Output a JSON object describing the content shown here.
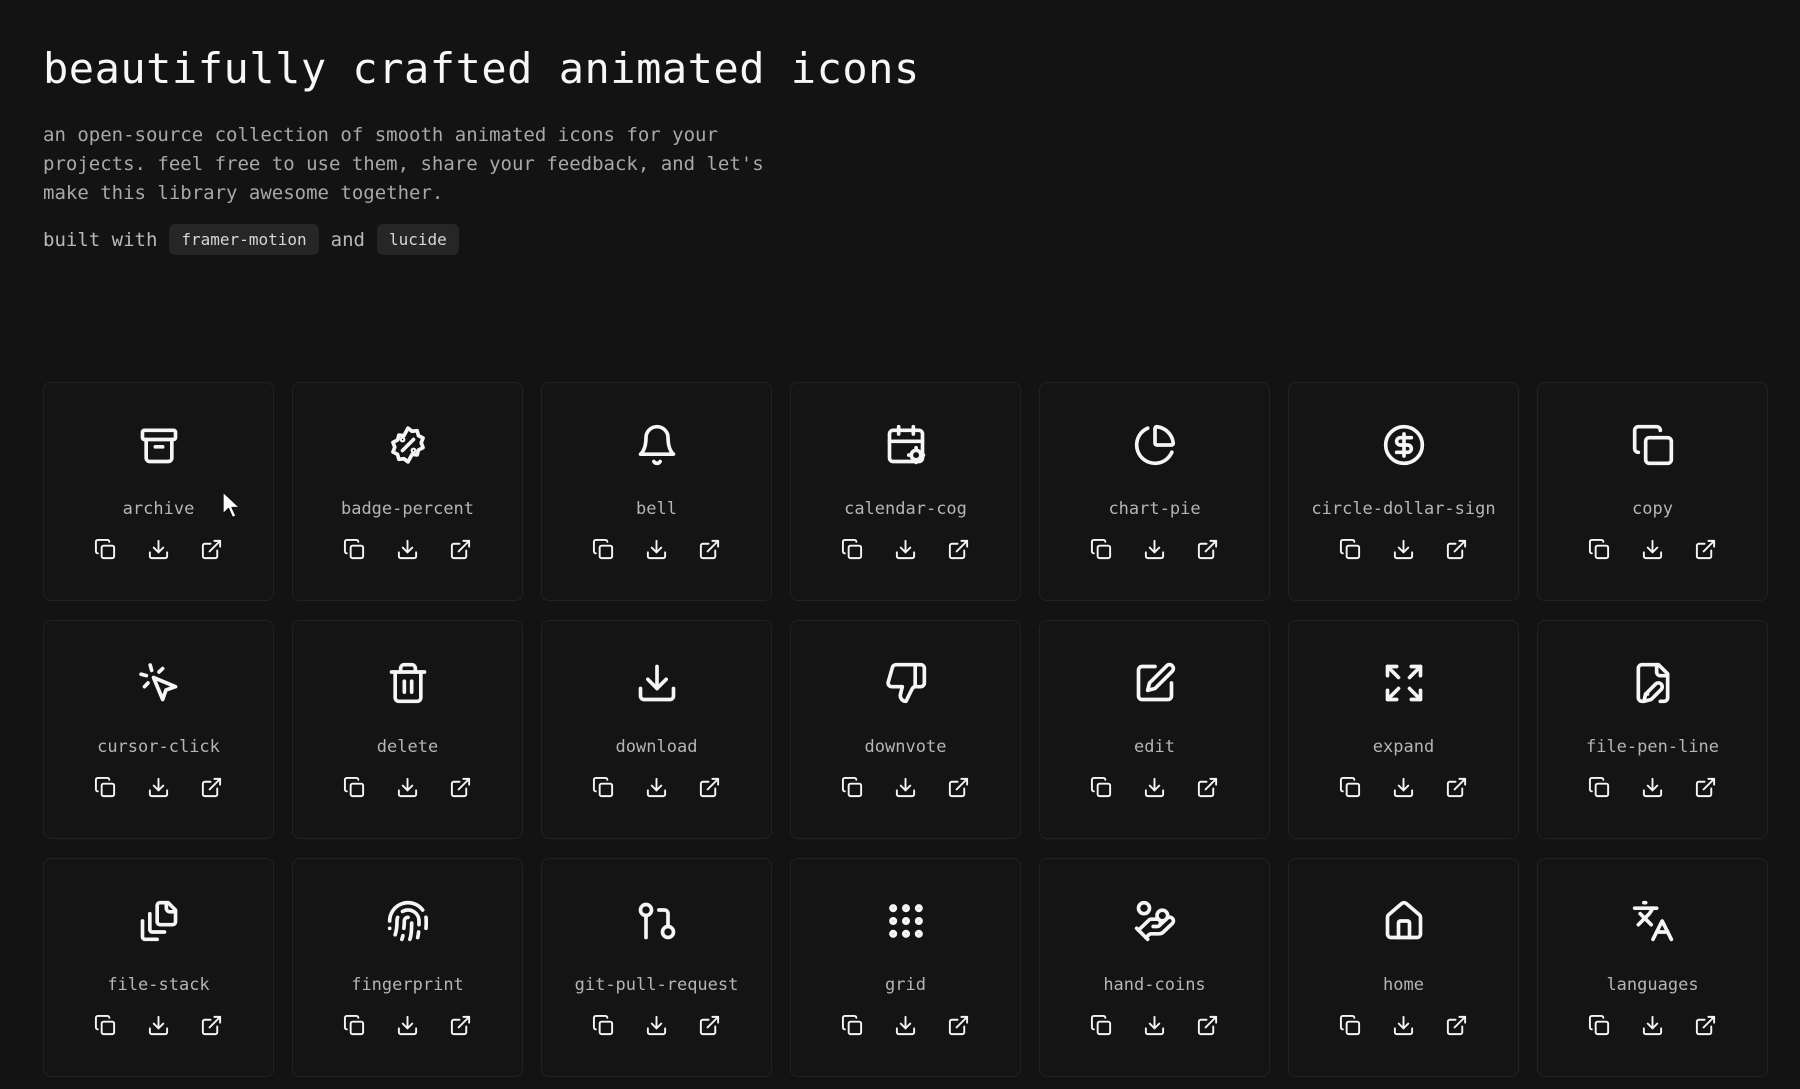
{
  "header": {
    "title": "beautifully crafted animated icons",
    "description": "an open-source collection of smooth animated icons for your projects. feel free to use them, share your feedback, and let's make this library awesome together.",
    "built_with": "built with",
    "and": "and",
    "chip1": "framer-motion",
    "chip2": "lucide"
  },
  "icons": [
    {
      "name": "archive"
    },
    {
      "name": "badge-percent"
    },
    {
      "name": "bell"
    },
    {
      "name": "calendar-cog"
    },
    {
      "name": "chart-pie"
    },
    {
      "name": "circle-dollar-sign"
    },
    {
      "name": "copy"
    },
    {
      "name": "cursor-click"
    },
    {
      "name": "delete"
    },
    {
      "name": "download"
    },
    {
      "name": "downvote"
    },
    {
      "name": "edit"
    },
    {
      "name": "expand"
    },
    {
      "name": "file-pen-line"
    },
    {
      "name": "file-stack"
    },
    {
      "name": "fingerprint"
    },
    {
      "name": "git-pull-request"
    },
    {
      "name": "grid"
    },
    {
      "name": "hand-coins"
    },
    {
      "name": "home"
    },
    {
      "name": "languages"
    }
  ],
  "actions": [
    "copy-icon",
    "download-icon",
    "external-link-icon"
  ]
}
